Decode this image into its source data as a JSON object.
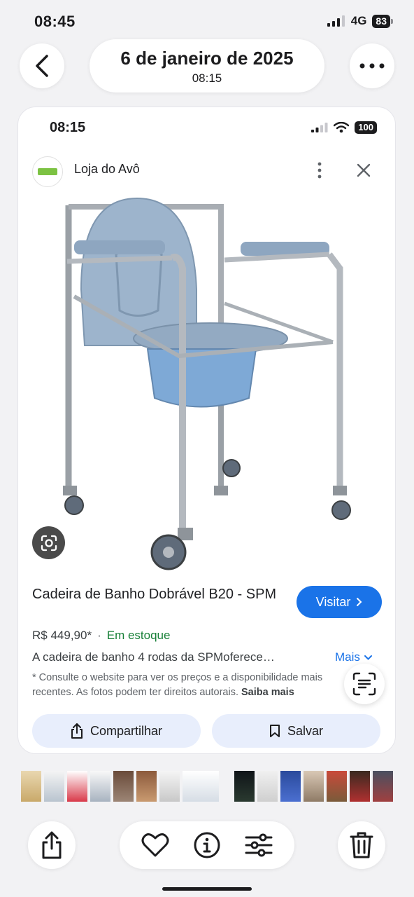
{
  "status_bar": {
    "time": "08:45",
    "network": "4G",
    "battery": "83"
  },
  "nav": {
    "date": "6 de janeiro de 2025",
    "time": "08:15"
  },
  "inner_status": {
    "time": "08:15",
    "battery": "100"
  },
  "store": {
    "name": "Loja do Avô"
  },
  "product": {
    "title": "Cadeira de Banho Dobrável B20 - SPM",
    "visit_label": "Visitar",
    "price": "R$ 449,90*",
    "separator": "·",
    "stock": "Em estoque",
    "description": "A cadeira de banho 4 rodas da SPMoferece…",
    "more_label": "Mais",
    "disclaimer": "* Consulte o website para ver os preços e a disponibilidade mais recentes. As fotos podem ter direitos autorais.",
    "disclaimer_link": "Saiba mais"
  },
  "actions": {
    "share_label": "Compartilhar",
    "save_label": "Salvar"
  },
  "colors": {
    "accent": "#1a73e8",
    "stock_green": "#188038",
    "button_bg": "#e8eefc"
  },
  "icons": [
    "back-arrow-icon",
    "more-horizontal-icon",
    "kebab-menu-icon",
    "close-icon",
    "google-lens-icon",
    "chevron-right-icon",
    "chevron-down-icon",
    "text-scan-icon",
    "share-icon",
    "bookmark-icon",
    "heart-icon",
    "info-icon",
    "adjust-icon",
    "trash-icon"
  ]
}
